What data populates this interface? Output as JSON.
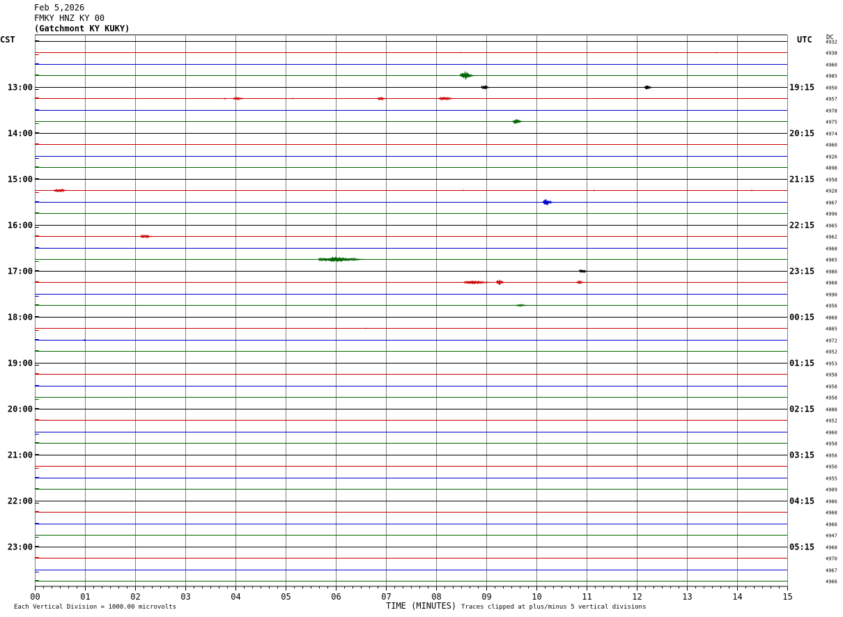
{
  "header": {
    "date": "Feb 5,2026",
    "station": "FMKY HNZ KY 00",
    "location": "(Gatchmont KY KUKY)"
  },
  "left_axis_title": "CST",
  "right_axis_title": "UTC",
  "dc_label": "DC",
  "footer": {
    "scale_note": "Each Vertical Division = 1000.00 microvolts",
    "xaxis_title": "TIME (MINUTES)",
    "clip_note": "Traces clipped at plus/minus 5 vertical divisions"
  },
  "colors": {
    "black": "#000000",
    "red": "#cc0000",
    "blue": "#0000cc",
    "green": "#006600",
    "grid": "#808080"
  },
  "chart_data": {
    "type": "helicorder",
    "x_ticks": [
      "00",
      "01",
      "02",
      "03",
      "04",
      "05",
      "06",
      "07",
      "08",
      "09",
      "10",
      "11",
      "12",
      "13",
      "14",
      "15"
    ],
    "xlim": [
      0,
      15
    ],
    "trace_minutes": 15,
    "trace_count": 48,
    "trace_color_cycle": [
      "black",
      "red",
      "blue",
      "green"
    ],
    "left_hour_labels": [
      "13:00",
      "14:00",
      "15:00",
      "16:00",
      "17:00",
      "18:00",
      "19:00",
      "20:00",
      "21:00",
      "22:00",
      "23:00"
    ],
    "left_hour_label_traces": [
      4,
      8,
      12,
      16,
      20,
      24,
      28,
      32,
      36,
      40,
      44
    ],
    "right_hour_labels": [
      "19:15",
      "20:15",
      "21:15",
      "22:15",
      "23:15",
      "00:15",
      "01:15",
      "02:15",
      "03:15",
      "04:15",
      "05:15"
    ],
    "dc_values": [
      "4932",
      "4938",
      "4960",
      "4985",
      "4950",
      "4957",
      "4978",
      "4975",
      "4974",
      "4960",
      "4926",
      "4898",
      "4958",
      "4928",
      "4967",
      "4996",
      "4965",
      "4962",
      "4968",
      "4965",
      "4980",
      "4968",
      "4990",
      "4956",
      "4868",
      "4865",
      "4972",
      "4952",
      "4953",
      "4958",
      "4958",
      "4958",
      "4888",
      "4952",
      "4960",
      "4958",
      "4956",
      "4950",
      "4955",
      "4909",
      "4986",
      "4968",
      "4966",
      "4947",
      "4968",
      "4970",
      "4967",
      "4966"
    ],
    "events": [
      {
        "trace": 1,
        "minute": 8.5,
        "amplitude": 0.5,
        "duration": 0.05
      },
      {
        "trace": 1,
        "minute": 13.6,
        "amplitude": 0.5,
        "duration": 0.05
      },
      {
        "trace": 3,
        "minute": 8.65,
        "amplitude": 6,
        "duration": 0.35
      },
      {
        "trace": 4,
        "minute": 9.0,
        "amplitude": 4,
        "duration": 0.2
      },
      {
        "trace": 4,
        "minute": 12.25,
        "amplitude": 3,
        "duration": 0.2
      },
      {
        "trace": 5,
        "minute": 3.8,
        "amplitude": 0.8,
        "duration": 0.05
      },
      {
        "trace": 5,
        "minute": 4.1,
        "amplitude": 1.8,
        "duration": 0.3
      },
      {
        "trace": 5,
        "minute": 5.15,
        "amplitude": 0.8,
        "duration": 0.05
      },
      {
        "trace": 5,
        "minute": 6.95,
        "amplitude": 2,
        "duration": 0.25
      },
      {
        "trace": 5,
        "minute": 8.25,
        "amplitude": 2,
        "duration": 0.4
      },
      {
        "trace": 7,
        "minute": 9.65,
        "amplitude": 4,
        "duration": 0.25
      },
      {
        "trace": 13,
        "minute": 0.55,
        "amplitude": 2.5,
        "duration": 0.35
      },
      {
        "trace": 13,
        "minute": 8.55,
        "amplitude": 0.6,
        "duration": 0.05
      },
      {
        "trace": 13,
        "minute": 11.15,
        "amplitude": 0.6,
        "duration": 0.05
      },
      {
        "trace": 13,
        "minute": 14.3,
        "amplitude": 0.6,
        "duration": 0.05
      },
      {
        "trace": 14,
        "minute": 10.25,
        "amplitude": 5,
        "duration": 0.25
      },
      {
        "trace": 17,
        "minute": 2.25,
        "amplitude": 2.5,
        "duration": 0.3
      },
      {
        "trace": 19,
        "minute": 6.25,
        "amplitude": 4,
        "duration": 1.2
      },
      {
        "trace": 20,
        "minute": 10.95,
        "amplitude": 3,
        "duration": 0.2
      },
      {
        "trace": 21,
        "minute": 8.9,
        "amplitude": 2.5,
        "duration": 0.7
      },
      {
        "trace": 21,
        "minute": 9.3,
        "amplitude": 4,
        "duration": 0.2
      },
      {
        "trace": 21,
        "minute": 10.9,
        "amplitude": 2,
        "duration": 0.2
      },
      {
        "trace": 23,
        "minute": 9.75,
        "amplitude": 1.2,
        "duration": 0.35
      },
      {
        "trace": 25,
        "minute": 6.6,
        "amplitude": 0.5,
        "duration": 0.05
      },
      {
        "trace": 26,
        "minute": 1.0,
        "amplitude": 1,
        "duration": 0.05
      }
    ]
  }
}
